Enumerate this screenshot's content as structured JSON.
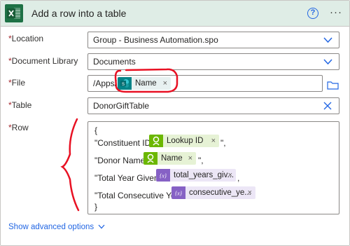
{
  "header": {
    "title": "Add a row into a table",
    "help_glyph": "?",
    "more_glyph": "···",
    "accent": "#dfede6"
  },
  "fields": {
    "location": {
      "label": "Location",
      "value": "Group - Business Automation.spo"
    },
    "document_library": {
      "label": "Document Library",
      "value": "Documents"
    },
    "file": {
      "label": "File",
      "prefix": "/Apps/",
      "token": "Name"
    },
    "table": {
      "label": "Table",
      "value": "DonorGiftTable"
    },
    "row": {
      "label": "Row",
      "open_brace": "{",
      "close_brace": "}",
      "lines": [
        {
          "key": "\"Constituent ID\": \"",
          "token": "Lookup ID",
          "suffix": "\",",
          "token_kind": "forms"
        },
        {
          "key": "\"Donor Name\": \"",
          "token": "Name",
          "suffix": "\",",
          "token_kind": "forms"
        },
        {
          "key": "\"Total Year Given\": ",
          "token": "total_years_giv...",
          "suffix": ",",
          "token_kind": "expression"
        },
        {
          "key": "\"Total Consecutive Year\": ",
          "token": "consecutive_ye...",
          "suffix": "",
          "token_kind": "expression"
        }
      ]
    }
  },
  "required_mark": "*",
  "remove_glyph": "×",
  "advanced_label": "Show advanced options",
  "colors": {
    "excel_green": "#1e7145",
    "sharepoint_teal": "#038387",
    "forms_green": "#6bb700",
    "expression_purple": "#8661c5",
    "link_blue": "#2266e3",
    "annotation_red": "#e81123"
  }
}
